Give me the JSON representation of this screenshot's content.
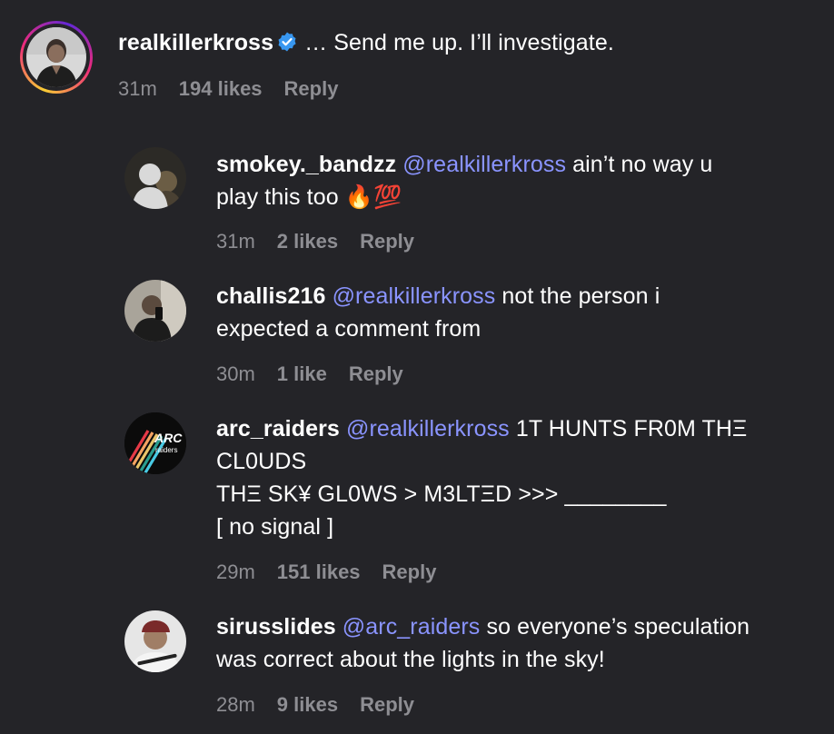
{
  "comments": [
    {
      "username": "realkillerkross",
      "verified": true,
      "mention": "",
      "text": "… Send me up. I’ll investigate.",
      "time": "31m",
      "likes": "194 likes",
      "reply": "Reply",
      "avatar_icon": "profile-photo-man"
    },
    {
      "username": "smokey._bandzz",
      "mention": "@realkillerkross",
      "text_line1": "ain’t no way u",
      "text_line2": "play this too 🔥💯",
      "time": "31m",
      "likes": "2 likes",
      "reply": "Reply",
      "avatar_icon": "profile-photo-dark"
    },
    {
      "username": "challis216",
      "mention": "@realkillerkross",
      "text_line1": "not the person i",
      "text_line2": "expected a comment from",
      "time": "30m",
      "likes": "1 like",
      "reply": "Reply",
      "avatar_icon": "profile-photo-selfie"
    },
    {
      "username": "arc_raiders",
      "mention": "@realkillerkross",
      "text_line1": "1T HUNTS FR0M THΞ",
      "text_line2": "CL0UDS",
      "text_line3": "THΞ SK¥ GL0WS > M3LTΞD >>> ________",
      "text_line4": "[ no signal ]",
      "time": "29m",
      "likes": "151 likes",
      "reply": "Reply",
      "avatar_icon": "arc-raiders-logo",
      "logo_text_1": "ARC",
      "logo_text_2": "raiders"
    },
    {
      "username": "sirusslides",
      "mention": "@arc_raiders",
      "text_line1": "so everyone’s speculation",
      "text_line2": "was correct about the lights in the sky!",
      "time": "28m",
      "likes": "9 likes",
      "reply": "Reply",
      "avatar_icon": "profile-photo-cap"
    }
  ],
  "colors": {
    "background": "#242428",
    "mention": "#8a94ff",
    "meta": "#8e8e93",
    "verified": "#3897f0"
  }
}
